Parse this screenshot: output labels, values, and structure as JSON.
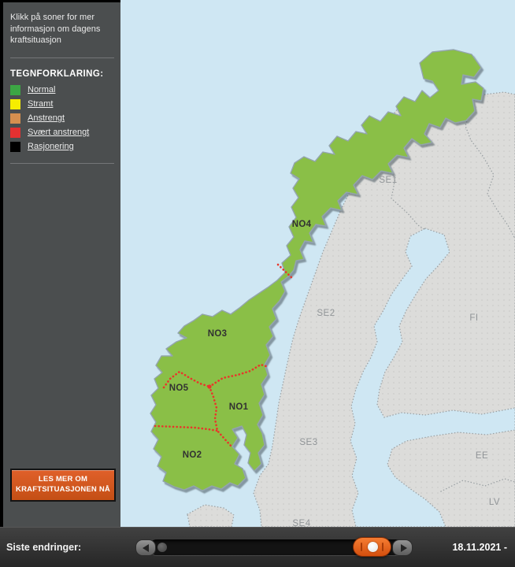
{
  "sidebar": {
    "intro": "Klikk på soner for mer informasjon om dagens kraftsituasjon",
    "legend_title": "TEGNFORKLARING:",
    "legend": [
      {
        "label": "Normal",
        "color": "#3ca644"
      },
      {
        "label": "Stramt",
        "color": "#f6ed00"
      },
      {
        "label": "Anstrengt",
        "color": "#d78f4f"
      },
      {
        "label": "Svært anstrengt",
        "color": "#e33131"
      },
      {
        "label": "Rasjonering",
        "color": "#000000"
      }
    ],
    "cta": {
      "line1": "LES MER OM",
      "line2": "KRAFTSITUASJONEN NÅ"
    }
  },
  "map": {
    "norway_status": "Normal",
    "zone_labels": [
      {
        "id": "NO4",
        "text": "NO4"
      },
      {
        "id": "NO3",
        "text": "NO3"
      },
      {
        "id": "NO5",
        "text": "NO5"
      },
      {
        "id": "NO1",
        "text": "NO1"
      },
      {
        "id": "NO2",
        "text": "NO2"
      }
    ],
    "neighbor_labels": [
      {
        "id": "SE1",
        "text": "SE1"
      },
      {
        "id": "SE2",
        "text": "SE2"
      },
      {
        "id": "SE3",
        "text": "SE3"
      },
      {
        "id": "SE4",
        "text": "SE4"
      },
      {
        "id": "FI",
        "text": "FI"
      },
      {
        "id": "EE",
        "text": "EE"
      },
      {
        "id": "LV",
        "text": "LV"
      }
    ],
    "colors": {
      "sea": "#cfe7f3",
      "land": "#dcdcda",
      "norway": "#8abf46",
      "zone_border": "#e8362a"
    }
  },
  "bottombar": {
    "label": "Siste endringer:",
    "date": "18.11.2021 -"
  }
}
